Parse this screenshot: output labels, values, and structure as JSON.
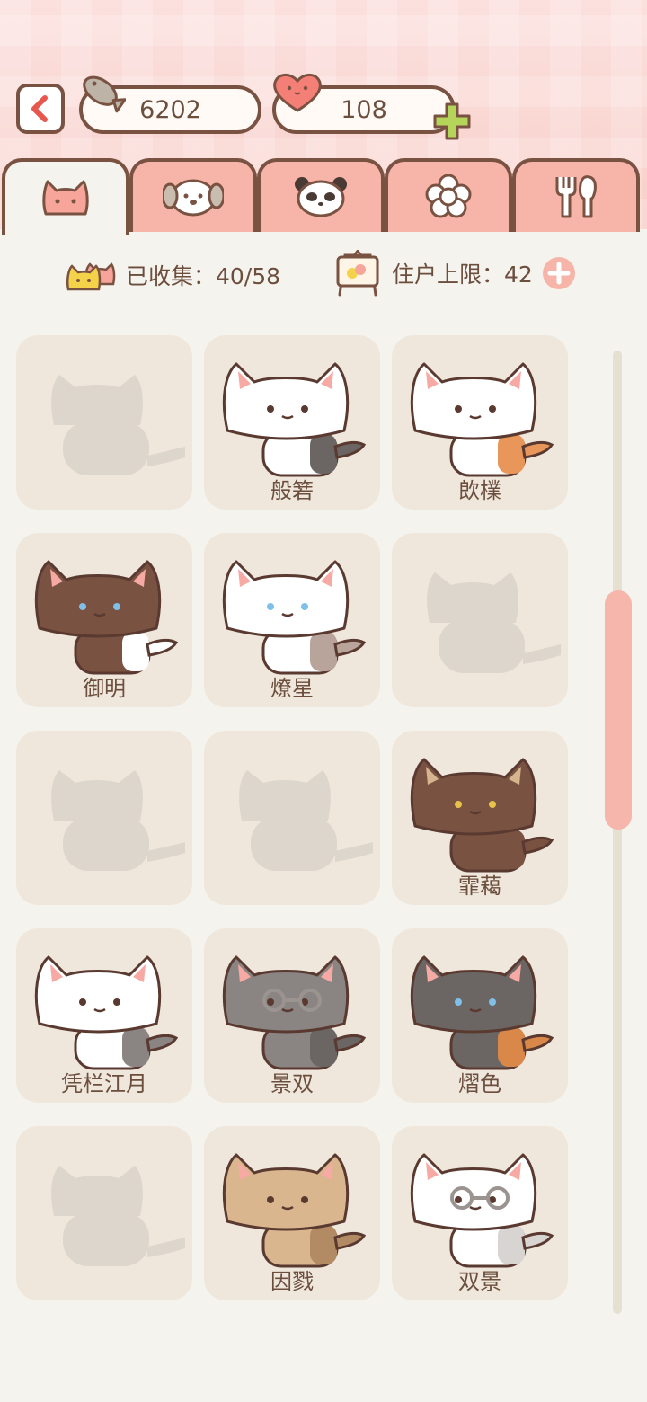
{
  "header": {
    "fish_count": "6202",
    "heart_count": "108"
  },
  "tabs": [
    {
      "icon": "cat-icon",
      "active": true
    },
    {
      "icon": "dog-icon",
      "active": false
    },
    {
      "icon": "panda-icon",
      "active": false
    },
    {
      "icon": "flower-icon",
      "active": false
    },
    {
      "icon": "utensils-icon",
      "active": false
    }
  ],
  "stats": {
    "collected_label": "已收集：40/58",
    "capacity_label": "住户上限：42"
  },
  "cats": [
    {
      "name": "",
      "locked": true
    },
    {
      "name": "般箬",
      "locked": false
    },
    {
      "name": "欴檏",
      "locked": false
    },
    {
      "name": "御明",
      "locked": false
    },
    {
      "name": "燎星",
      "locked": false
    },
    {
      "name": "",
      "locked": true
    },
    {
      "name": "",
      "locked": true
    },
    {
      "name": "",
      "locked": true
    },
    {
      "name": "霏藒",
      "locked": false
    },
    {
      "name": "凭栏江月",
      "locked": false
    },
    {
      "name": "景双",
      "locked": false
    },
    {
      "name": "熠色",
      "locked": false
    },
    {
      "name": "",
      "locked": true
    },
    {
      "name": "因戮",
      "locked": false
    },
    {
      "name": "双景",
      "locked": false
    }
  ],
  "colors": {
    "accent": "#f7b5a9",
    "outline": "#7a5242",
    "card": "#efe7dc",
    "background": "#f5f3ee"
  }
}
